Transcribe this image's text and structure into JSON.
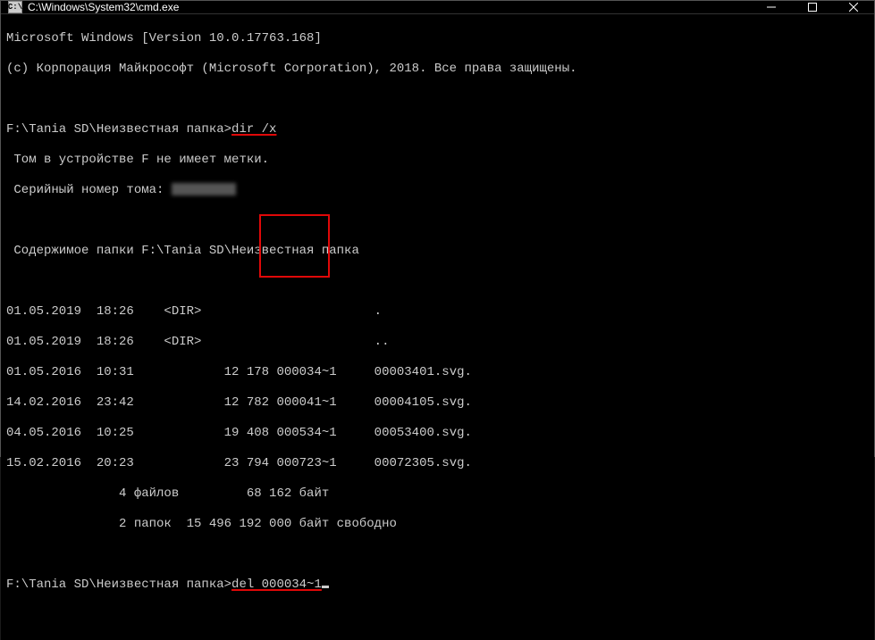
{
  "titlebar": {
    "icon_text": "C:\\",
    "title": "C:\\Windows\\System32\\cmd.exe"
  },
  "intro": {
    "line1": "Microsoft Windows [Version 10.0.17763.168]",
    "line2": "(c) Корпорация Майкрософт (Microsoft Corporation), 2018. Все права защищены."
  },
  "prompt1": {
    "path": "F:\\Tania SD\\Неизвестная папка>",
    "cmd": "dir /x"
  },
  "volume": {
    "line1": " Том в устройстве F не имеет метки.",
    "line2_prefix": " Серийный номер тома: "
  },
  "contents_header": " Содержимое папки F:\\Tania SD\\Неизвестная папка",
  "dir_listing": {
    "row0": "01.05.2019  18:26    <DIR>                       .",
    "row1": "01.05.2019  18:26    <DIR>                       ..",
    "row2_a": "01.05.2016  10:31            12 178 ",
    "row2_short": "000034~1",
    "row2_b": "     00003401.svg.",
    "row3_a": "14.02.2016  23:42            12 782 ",
    "row3_short": "000041~1",
    "row3_b": "     00004105.svg.",
    "row4_a": "04.05.2016  10:25            19 408 ",
    "row4_short": "000534~1",
    "row4_b": "     00053400.svg.",
    "row5_a": "15.02.2016  20:23            23 794 ",
    "row5_short": "000723~1",
    "row5_b": "     00072305.svg.",
    "summary1": "               4 файлов         68 162 байт",
    "summary2": "               2 папок  15 496 192 000 байт свободно"
  },
  "prompt2": {
    "path": "F:\\Tania SD\\Неизвестная папка>",
    "cmd": "del 000034~1"
  }
}
